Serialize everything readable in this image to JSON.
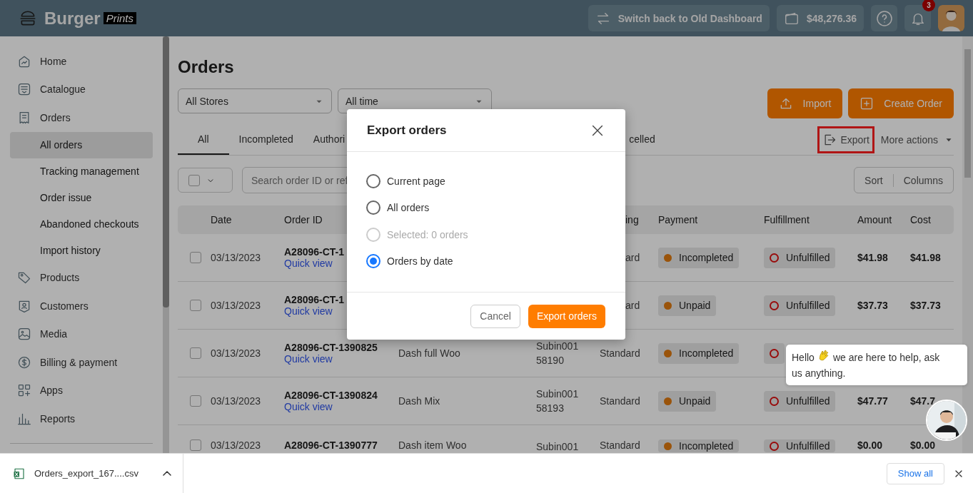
{
  "header": {
    "logo_word": "Burger",
    "logo_tag": "Prints",
    "switch_button": "Switch back to Old Dashboard",
    "balance": "$48,276.36",
    "notification_count": "3"
  },
  "sidebar": {
    "items": [
      {
        "label": "Home",
        "selected": false
      },
      {
        "label": "Catalogue",
        "selected": false
      },
      {
        "label": "Orders",
        "selected": false,
        "children": [
          {
            "label": "All orders",
            "selected": true
          },
          {
            "label": "Tracking management",
            "selected": false
          },
          {
            "label": "Order issue",
            "selected": false
          },
          {
            "label": "Abandoned checkouts",
            "selected": false
          },
          {
            "label": "Import history",
            "selected": false
          }
        ]
      },
      {
        "label": "Products",
        "selected": false
      },
      {
        "label": "Customers",
        "selected": false
      },
      {
        "label": "Media",
        "selected": false
      },
      {
        "label": "Billing & payment",
        "selected": false
      },
      {
        "label": "Apps",
        "selected": false
      },
      {
        "label": "Reports",
        "selected": false
      }
    ]
  },
  "page": {
    "title": "Orders",
    "filters": [
      {
        "value": "All Stores"
      },
      {
        "value": "All time"
      }
    ],
    "import_button": "Import",
    "create_button": "Create Order",
    "tabs": [
      {
        "label": "All",
        "selected": true
      },
      {
        "label": "Incompleted",
        "selected": false
      },
      {
        "label": "Authori",
        "selected": false
      },
      {
        "label": "celled",
        "selected": false
      }
    ],
    "export_link": "Export",
    "more_actions": "More actions",
    "search": {
      "placeholder": "Search order ID or ref"
    },
    "sort_button": "Sort",
    "columns_button": "Columns",
    "table": {
      "columns": {
        "date": "Date",
        "order_id": "Order ID",
        "shipping_tail": "ing",
        "payment": "Payment",
        "fulfillment": "Fulfillment",
        "amount": "Amount",
        "cost": "Cost"
      },
      "rows": [
        {
          "checked": false,
          "date": "03/13/2023",
          "order_id": "A28096-CT-1",
          "quick_view": "Quick view",
          "shipping_tail": "ard",
          "payment": "Incompleted",
          "fulfillment": "Unfulfilled",
          "amount": "$41.98",
          "cost": "$41.98"
        },
        {
          "checked": false,
          "date": "03/13/2023",
          "order_id": "A28096-CT-1",
          "quick_view": "Quick view",
          "shipping_tail": "ard",
          "payment": "Unpaid",
          "fulfillment": "Unfulfilled",
          "amount": "$37.73",
          "cost": "$37.73"
        },
        {
          "checked": false,
          "date": "03/13/2023",
          "order_id": "A28096-CT-1390825",
          "quick_view": "Quick view",
          "product": "Dash full Woo",
          "store": [
            "Subin001",
            "58190"
          ],
          "shipping": "Standard",
          "payment": "Incompleted"
        },
        {
          "checked": false,
          "date": "03/13/2023",
          "order_id": "A28096-CT-1390824",
          "quick_view": "Quick view",
          "product": "Dash Mix",
          "store": [
            "Subin001",
            "58193"
          ],
          "shipping": "Standard",
          "payment": "Unpaid",
          "fulfillment": "Unfulfilled",
          "amount": "$47.77",
          "cost": "$47.7"
        },
        {
          "checked": false,
          "date": "03/13/2023",
          "order_id": "A28096-CT-1390777",
          "product": "Dash item Woo",
          "store": [
            "Subin001"
          ],
          "shipping": "Standard",
          "payment": "Incompleted",
          "fulfillment": "Unfulfilled",
          "amount": "$0.00",
          "cost": "$0.00"
        }
      ]
    }
  },
  "modal": {
    "title": "Export orders",
    "options": [
      {
        "label": "Current page",
        "selected": false,
        "disabled": false
      },
      {
        "label": "All orders",
        "selected": false,
        "disabled": false
      },
      {
        "label": "Selected: 0 orders",
        "selected": false,
        "disabled": true
      },
      {
        "label": "Orders by date",
        "selected": true,
        "disabled": false
      }
    ],
    "cancel_button": "Cancel",
    "confirm_button": "Export orders"
  },
  "chat": {
    "greeting": "Hello",
    "message": "we are here to help, ask",
    "message_end": "us anything."
  },
  "download_bar": {
    "file_name": "Orders_export_167....csv",
    "show_all_button": "Show all"
  }
}
